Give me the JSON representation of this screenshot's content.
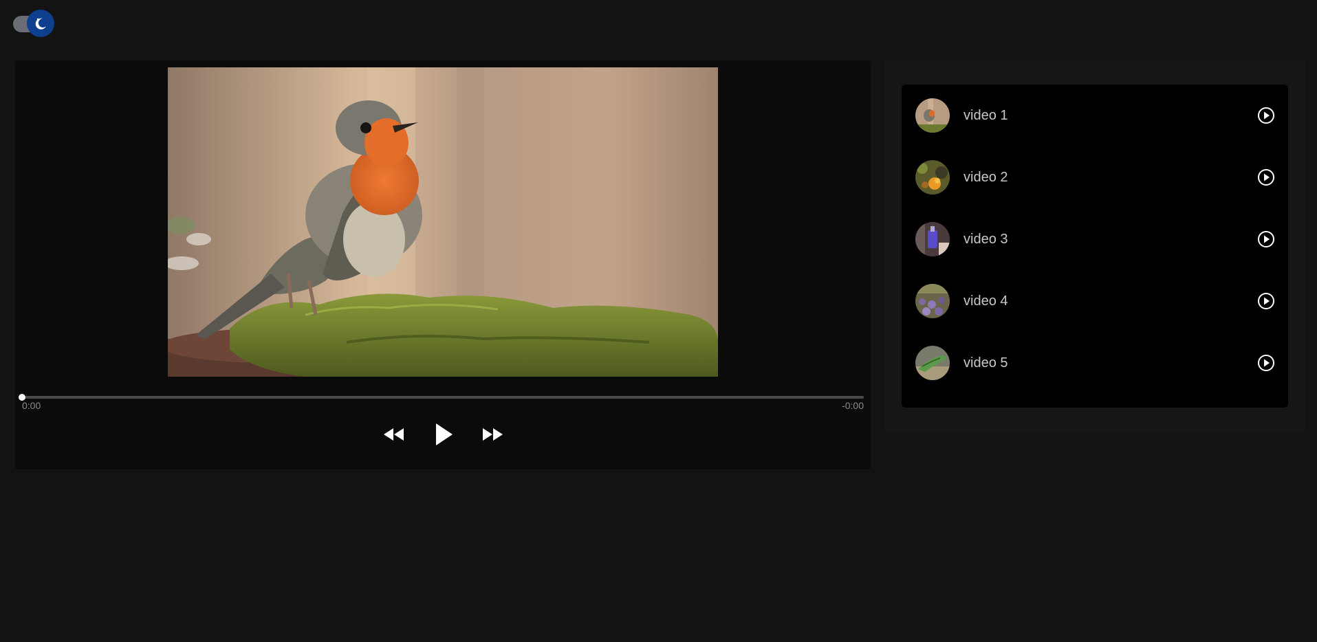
{
  "theme_toggle": {
    "mode": "dark",
    "icon": "moon-icon",
    "colors": {
      "track": "#6a6e74",
      "knob": "#0e3f8f"
    }
  },
  "player": {
    "now_playing_image": "robin-on-moss",
    "progress": 0,
    "time_current": "0:00",
    "time_remaining": "-0:00",
    "controls": {
      "rewind_icon": "rewind-icon",
      "play_icon": "play-icon",
      "forward_icon": "fast-forward-icon"
    }
  },
  "playlist": {
    "items": [
      {
        "label": "video 1",
        "thumb": "robin-thumbnail",
        "icon": "play-circle-icon"
      },
      {
        "label": "video 2",
        "thumb": "orange-flowers-thumbnail",
        "icon": "play-circle-icon"
      },
      {
        "label": "video 3",
        "thumb": "purple-bottle-thumbnail",
        "icon": "play-circle-icon"
      },
      {
        "label": "video 4",
        "thumb": "lavender-field-thumbnail",
        "icon": "play-circle-icon"
      },
      {
        "label": "video 5",
        "thumb": "green-lizard-thumbnail",
        "icon": "play-circle-icon"
      }
    ]
  },
  "colors": {
    "background": "#131313",
    "player_panel": "#0b0b0b",
    "playlist_panel": "#161616",
    "playlist_list": "#000000",
    "label_text": "#c8c8c8",
    "time_text": "#8a8a8a"
  }
}
